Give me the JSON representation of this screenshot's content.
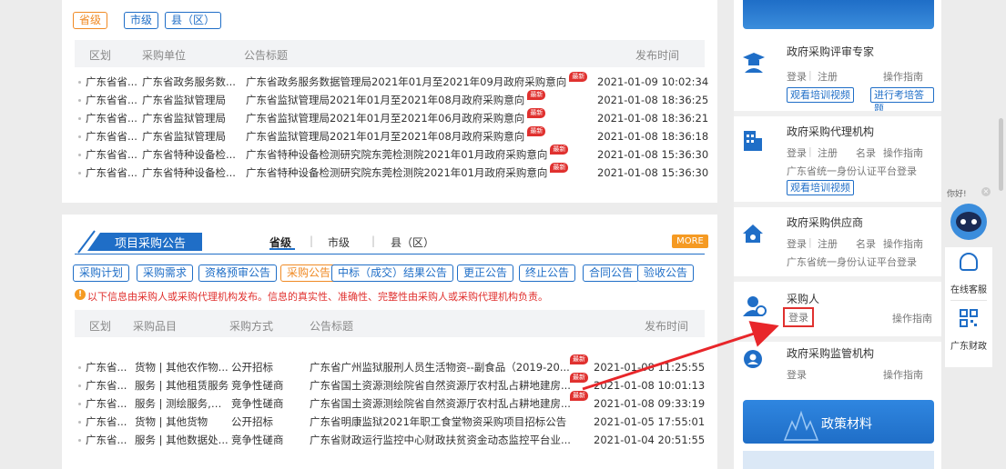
{
  "intent": {
    "levels": [
      "省级",
      "市级",
      "县（区）"
    ],
    "headers": [
      "区划",
      "采购单位",
      "公告标题",
      "发布时间"
    ],
    "rows": [
      {
        "region": "广东省省...",
        "unit": "广东省政务服务数...",
        "title": "广东省政务服务数据管理局2021年01月至2021年09月政府采购意向",
        "new": "最新",
        "time": "2021-01-09 10:02:34"
      },
      {
        "region": "广东省省...",
        "unit": "广东省监狱管理局",
        "title": "广东省监狱管理局2021年01月至2021年08月政府采购意向",
        "new": "最新",
        "time": "2021-01-08 18:36:25"
      },
      {
        "region": "广东省省...",
        "unit": "广东省监狱管理局",
        "title": "广东省监狱管理局2021年01月至2021年06月政府采购意向",
        "new": "最新",
        "time": "2021-01-08 18:36:21"
      },
      {
        "region": "广东省省...",
        "unit": "广东省监狱管理局",
        "title": "广东省监狱管理局2021年01月至2021年08月政府采购意向",
        "new": "最新",
        "time": "2021-01-08 18:36:18"
      },
      {
        "region": "广东省省...",
        "unit": "广东省特种设备检...",
        "title": "广东省特种设备检测研究院东莞检测院2021年01月政府采购意向",
        "new": "最新",
        "time": "2021-01-08 15:36:30"
      },
      {
        "region": "广东省省...",
        "unit": "广东省特种设备检...",
        "title": "广东省特种设备检测研究院东莞检测院2021年01月政府采购意向",
        "new": "最新",
        "time": "2021-01-08 15:36:30"
      }
    ]
  },
  "project": {
    "title": "项目采购公告",
    "levels": [
      "省级",
      "市级",
      "县（区）"
    ],
    "more": "MORE",
    "types": [
      "采购计划",
      "采购需求",
      "资格预审公告",
      "采购公告",
      "中标（成交）结果公告",
      "更正公告",
      "终止公告",
      "合同公告",
      "验收公告"
    ],
    "notice": "以下信息由采购人或采购代理机构发布。信息的真实性、准确性、完整性由采购人或采购代理机构负责。",
    "headers": [
      "区划",
      "采购品目",
      "采购方式",
      "公告标题",
      "发布时间"
    ],
    "rows": [
      {
        "region": "广东省...",
        "item": "货物 | 其他农作物...",
        "method": "公开招标",
        "title": "广东省广州监狱服刑人员生活物资--副食品（2019-20...",
        "new": "最新",
        "time": "2021-01-08 11:25:55"
      },
      {
        "region": "广东省...",
        "item": "服务 | 其他租赁服务",
        "method": "竞争性磋商",
        "title": "广东省国土资源测绘院省自然资源厅农村乱占耕地建房...",
        "new": "最新",
        "time": "2021-01-08 10:01:13"
      },
      {
        "region": "广东省...",
        "item": "服务 | 测绘服务,测...",
        "method": "竞争性磋商",
        "title": "广东省国土资源测绘院省自然资源厅农村乱占耕地建房...",
        "new": "最新",
        "time": "2021-01-08 09:33:19"
      },
      {
        "region": "广东省...",
        "item": "货物 | 其他货物",
        "method": "公开招标",
        "title": "广东省明康监狱2021年职工食堂物资采购项目招标公告",
        "new": "",
        "time": "2021-01-05 17:55:01"
      },
      {
        "region": "广东省...",
        "item": "服务 | 其他数据处...",
        "method": "竞争性磋商",
        "title": "广东省财政运行监控中心财政扶贫资金动态监控平台业...",
        "new": "",
        "time": "2021-01-04 20:51:55"
      }
    ]
  },
  "sidebar": {
    "expert": {
      "title": "政府采购评审专家",
      "login": "登录",
      "register": "注册",
      "guide": "操作指南",
      "btn1": "观看培训视频",
      "btn2": "进行考培答题"
    },
    "agency": {
      "title": "政府采购代理机构",
      "login": "登录",
      "register": "注册",
      "list": "名录",
      "guide": "操作指南",
      "auth": "广东省统一身份认证平台登录",
      "btn1": "观看培训视频"
    },
    "supplier": {
      "title": "政府采购供应商",
      "login": "登录",
      "register": "注册",
      "list": "名录",
      "guide": "操作指南",
      "auth": "广东省统一身份认证平台登录"
    },
    "purchaser": {
      "title": "采购人",
      "login": "登录",
      "guide": "操作指南"
    },
    "regulator": {
      "title": "政府采购监管机构",
      "login": "登录",
      "guide": "操作指南"
    },
    "policy": "政策材料"
  },
  "float": {
    "greeting": "你好!",
    "service": "在线客服",
    "finance": "广东财政"
  },
  "colors": {
    "blue": "#1f6ec7",
    "orange": "#f08a24",
    "red": "#e0312f"
  }
}
